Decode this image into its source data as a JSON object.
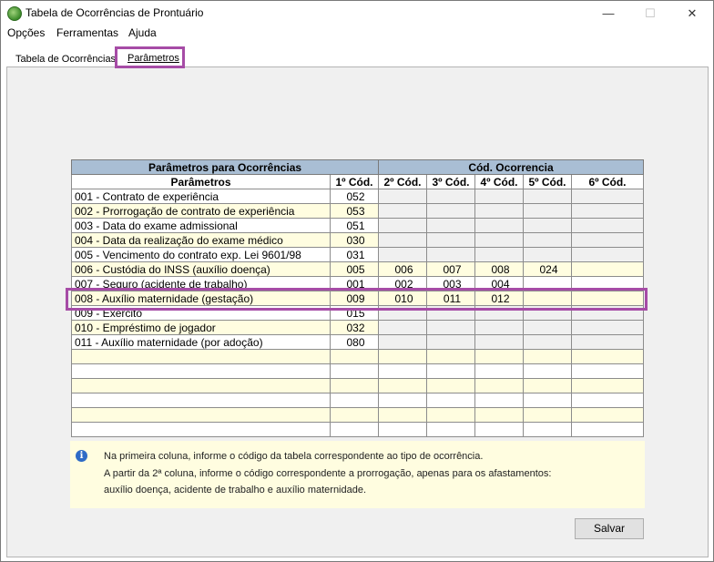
{
  "window": {
    "title": "Tabela de Ocorrências de Prontuário",
    "controls": {
      "minimize": "—",
      "maximize": "☐",
      "close": "✕"
    }
  },
  "menu": [
    "Opções",
    "Ferramentas",
    "Ajuda"
  ],
  "tabs": [
    "Tabela de Ocorrências",
    "Parâmetros"
  ],
  "active_tab": "Parâmetros",
  "grid": {
    "group_headers": {
      "left": "Parâmetros para Ocorrências",
      "right": "Cód. Ocorrencia"
    },
    "columns": [
      "Parâmetros",
      "1º Cód.",
      "2º Cód.",
      "3º Cód.",
      "4º Cód.",
      "5º Cód.",
      "6º Cód."
    ],
    "rows": [
      [
        "001 - Contrato de experiência",
        "052",
        "",
        "",
        "",
        "",
        ""
      ],
      [
        "002 - Prorrogação de contrato de experiência",
        "053",
        "",
        "",
        "",
        "",
        ""
      ],
      [
        "003 - Data do exame admissional",
        "051",
        "",
        "",
        "",
        "",
        ""
      ],
      [
        "004 - Data da realização do exame médico",
        "030",
        "",
        "",
        "",
        "",
        ""
      ],
      [
        "005 - Vencimento do contrato exp. Lei 9601/98",
        "031",
        "",
        "",
        "",
        "",
        ""
      ],
      [
        "006 - Custódia do INSS (auxílio doença)",
        "005",
        "006",
        "007",
        "008",
        "024",
        ""
      ],
      [
        "007 - Seguro (acidente de trabalho)",
        "001",
        "002",
        "003",
        "004",
        "",
        ""
      ],
      [
        "008 - Auxílio maternidade (gestação)",
        "009",
        "010",
        "011",
        "012",
        "",
        ""
      ],
      [
        "009 - Exercito",
        "015",
        "",
        "",
        "",
        "",
        ""
      ],
      [
        "010 - Empréstimo de jogador",
        "032",
        "",
        "",
        "",
        "",
        ""
      ],
      [
        "011 - Auxílio maternidade (por adoção)",
        "080",
        "",
        "",
        "",
        "",
        ""
      ],
      [
        "",
        "",
        "",
        "",
        "",
        "",
        ""
      ],
      [
        "",
        "",
        "",
        "",
        "",
        "",
        ""
      ],
      [
        "",
        "",
        "",
        "",
        "",
        "",
        ""
      ],
      [
        "",
        "",
        "",
        "",
        "",
        "",
        ""
      ],
      [
        "",
        "",
        "",
        "",
        "",
        "",
        ""
      ],
      [
        "",
        "",
        "",
        "",
        "",
        "",
        ""
      ]
    ],
    "highlighted_row": "008 - Auxílio maternidade (gestação)"
  },
  "info": {
    "lines": [
      "Na primeira coluna, informe o código da tabela correspondente ao tipo de ocorrência.",
      "A partir da 2ª coluna, informe o código correspondente a prorrogação, apenas para os afastamentos:",
      "auxílio doença, acidente de trabalho e auxílio maternidade."
    ]
  },
  "buttons": {
    "save": "Salvar"
  },
  "colors": {
    "grid_header": "#a9bed4",
    "row_highlight": "#fffde0",
    "annotation": "#a64ca6"
  }
}
